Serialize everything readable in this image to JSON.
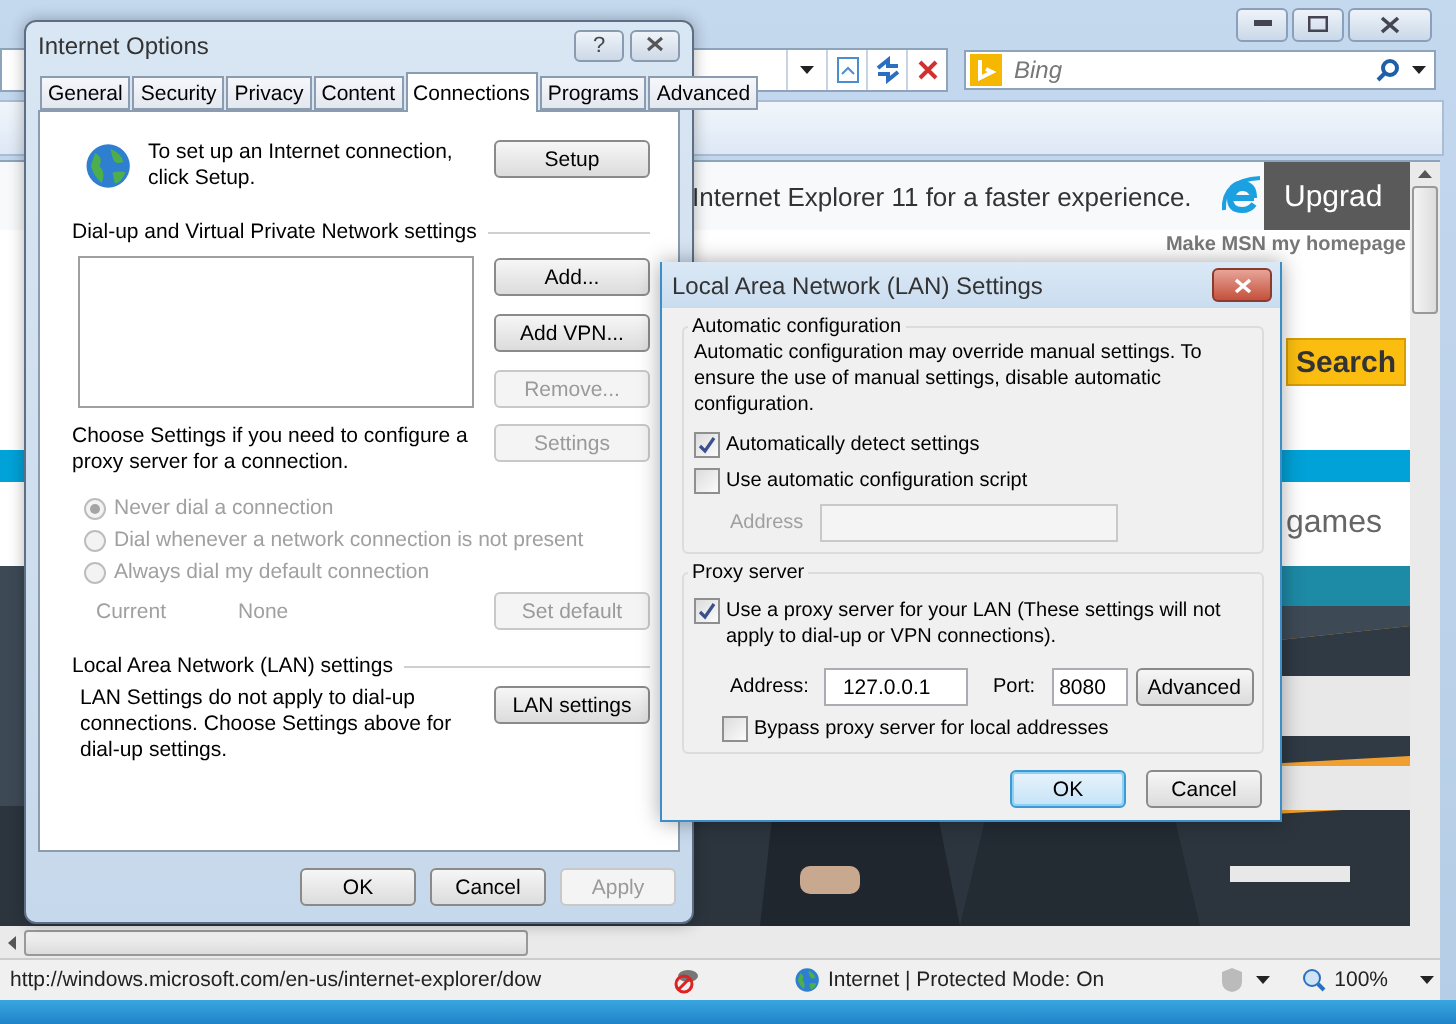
{
  "browser": {
    "search_placeholder": "Bing",
    "banner_text": "Internet Explorer 11 for a faster experience.",
    "upgrade": "Upgrad",
    "homepage_link": "Make MSN my homepage",
    "search_button": "Search",
    "games": "games",
    "status_url": "http://windows.microsoft.com/en-us/internet-explorer/dow",
    "zone": "Internet | Protected Mode: On",
    "zoom": "100%"
  },
  "internet_options": {
    "title": "Internet Options",
    "help": "?",
    "tabs": [
      {
        "label": "General",
        "selected": false
      },
      {
        "label": "Security",
        "selected": false
      },
      {
        "label": "Privacy",
        "selected": false
      },
      {
        "label": "Content",
        "selected": false
      },
      {
        "label": "Connections",
        "selected": true
      },
      {
        "label": "Programs",
        "selected": false
      },
      {
        "label": "Advanced",
        "selected": false
      }
    ],
    "setup_text": "To set up an Internet connection, click Setup.",
    "setup_button": "Setup",
    "vpn_heading": "Dial-up and Virtual Private Network settings",
    "vpn_buttons": [
      {
        "label": "Add...",
        "disabled": false
      },
      {
        "label": "Add VPN...",
        "disabled": false
      },
      {
        "label": "Remove...",
        "disabled": true
      }
    ],
    "settings_button": {
      "label": "Settings",
      "disabled": true
    },
    "proxy_text": "Choose Settings if you need to configure a proxy server for a connection.",
    "dial_options": [
      {
        "label": "Never dial a connection",
        "selected": true,
        "disabled": true
      },
      {
        "label": "Dial whenever a network connection is not present",
        "selected": false,
        "disabled": true
      },
      {
        "label": "Always dial my default connection",
        "selected": false,
        "disabled": true
      }
    ],
    "current_label": "Current",
    "current_value": "None",
    "set_default": {
      "label": "Set default",
      "disabled": true
    },
    "lan_heading": "Local Area Network (LAN) settings",
    "lan_text": "LAN Settings do not apply to dial-up connections. Choose Settings above for dial-up settings.",
    "lan_button": "LAN settings",
    "buttons": [
      {
        "label": "OK",
        "disabled": false
      },
      {
        "label": "Cancel",
        "disabled": false
      },
      {
        "label": "Apply",
        "disabled": true
      }
    ]
  },
  "lan_dialog": {
    "title": "Local Area Network (LAN) Settings",
    "auto_heading": "Automatic configuration",
    "auto_text": "Automatic configuration may override manual settings.  To ensure the use of manual settings, disable automatic configuration.",
    "auto_options": [
      {
        "label": "Automatically detect settings",
        "checked": true
      },
      {
        "label": "Use automatic configuration script",
        "checked": false
      }
    ],
    "script_address_label": "Address",
    "proxy_heading": "Proxy server",
    "proxy_option": {
      "label": "Use a proxy server for your LAN (These settings will not apply to dial-up or VPN connections).",
      "checked": true
    },
    "address_label": "Address:",
    "address_value": "127.0.0.1",
    "port_label": "Port:",
    "port_value": "8080",
    "advanced_button": "Advanced",
    "bypass": {
      "label": "Bypass proxy server for local addresses",
      "checked": false
    },
    "buttons": [
      {
        "label": "OK",
        "default": true
      },
      {
        "label": "Cancel",
        "default": false
      }
    ]
  }
}
